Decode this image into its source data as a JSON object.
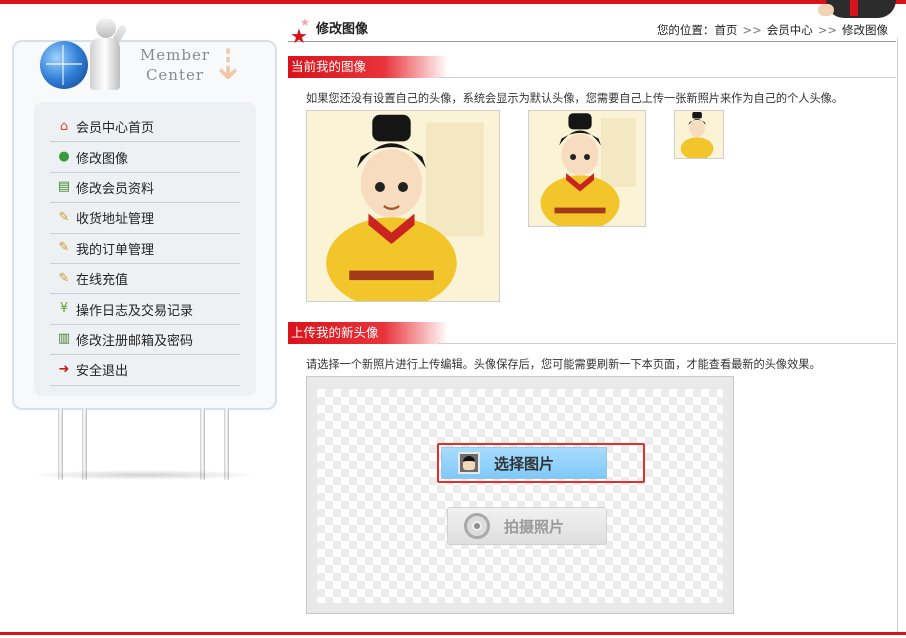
{
  "sidebar": {
    "header": {
      "title_line1": "Member",
      "title_line2": "Center"
    },
    "menu": [
      {
        "label": "会员中心首页",
        "icon": "home-icon",
        "glyph": "⌂"
      },
      {
        "label": "修改图像",
        "icon": "user-icon",
        "glyph": "●"
      },
      {
        "label": "修改会员资料",
        "icon": "cart-icon",
        "glyph": "▤"
      },
      {
        "label": "收货地址管理",
        "icon": "edit-note-icon",
        "glyph": "✎"
      },
      {
        "label": "我的订单管理",
        "icon": "edit-note-icon",
        "glyph": "✎"
      },
      {
        "label": "在线充值",
        "icon": "edit-note-icon",
        "glyph": "✎"
      },
      {
        "label": "操作日志及交易记录",
        "icon": "money-icon",
        "glyph": "¥"
      },
      {
        "label": "修改注册邮箱及密码",
        "icon": "book-icon",
        "glyph": "▥"
      },
      {
        "label": "安全退出",
        "icon": "exit-icon",
        "glyph": "➜"
      }
    ]
  },
  "header": {
    "title": "修改图像",
    "breadcrumb_prefix": "您的位置：",
    "breadcrumb": [
      "首页",
      "会员中心",
      "修改图像"
    ],
    "breadcrumb_sep": ">>"
  },
  "current_avatar": {
    "section_title": "当前我的图像",
    "description": "如果您还没有设置自己的头像，系统会显示为默认头像，您需要自己上传一张新照片来作为自己的个人头像。"
  },
  "upload": {
    "section_title": "上传我的新头像",
    "description": "请选择一个新照片进行上传编辑。头像保存后，您可能需要刷新一下本页面，才能查看最新的头像效果。",
    "select_button": "选择图片",
    "camera_button": "拍摄照片"
  },
  "colors": {
    "brand_red": "#d9131b",
    "select_button_bg": "#a8dcff",
    "highlight_border": "#e0312f"
  }
}
